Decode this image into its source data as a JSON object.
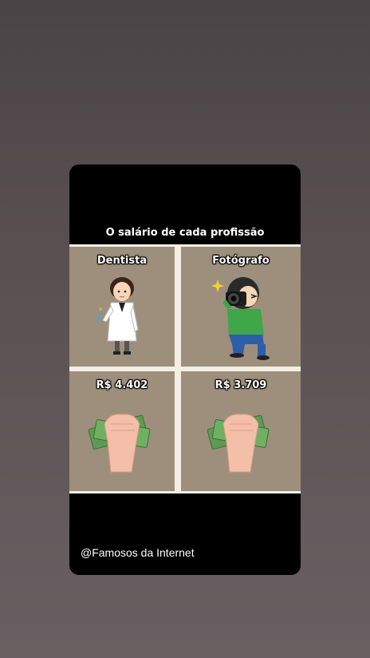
{
  "post": {
    "title": "O salário de cada profissão",
    "handle": "@Famosos da Internet"
  },
  "cells": [
    {
      "label": "Dentista",
      "icon": "dentist-illustration"
    },
    {
      "label": "Fotógrafo",
      "icon": "photographer-illustration"
    },
    {
      "label": "R$ 4.402",
      "icon": "money-in-fist-illustration"
    },
    {
      "label": "R$ 3.709",
      "icon": "money-in-fist-illustration"
    }
  ]
}
